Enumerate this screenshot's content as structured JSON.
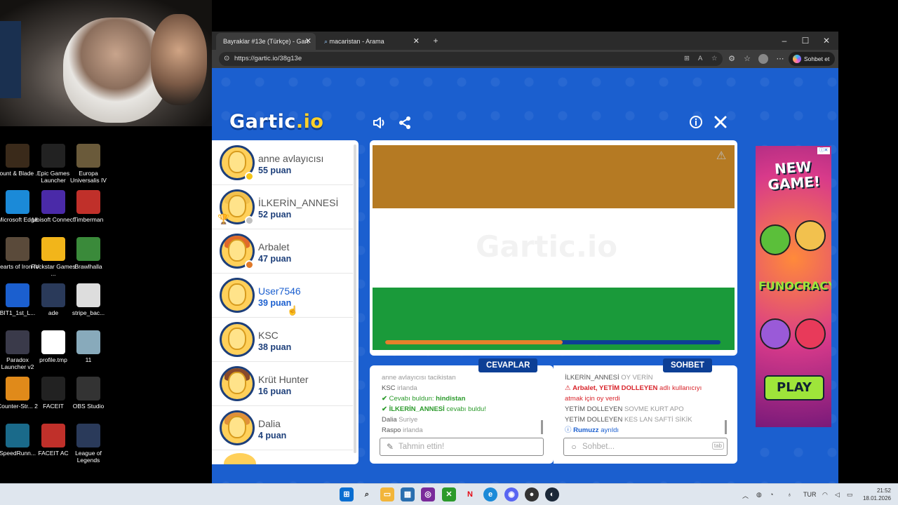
{
  "desktop": {
    "icons": [
      {
        "label": "Mount & Blade ...",
        "icon": "mount-blade-icon"
      },
      {
        "label": "Epic Games Launcher",
        "icon": "epic-games-icon"
      },
      {
        "label": "Europa Universalis IV",
        "icon": "europa-universalis-icon"
      },
      {
        "label": "Microsoft Edge",
        "icon": "edge-icon"
      },
      {
        "label": "Ubisoft Connect",
        "icon": "ubisoft-icon"
      },
      {
        "label": "Timberman",
        "icon": "timberman-icon"
      },
      {
        "label": "Hearts of Iron IV",
        "icon": "hearts-of-iron-icon"
      },
      {
        "label": "Rockstar Games ...",
        "icon": "rockstar-icon"
      },
      {
        "label": "Brawlhalla",
        "icon": "brawlhalla-icon"
      },
      {
        "label": "BIT1_1st_L...",
        "icon": "word-doc-icon"
      },
      {
        "label": "ade",
        "icon": "league-icon"
      },
      {
        "label": "stripe_bac...",
        "icon": "file-icon"
      },
      {
        "label": "Paradox Launcher v2",
        "icon": "paradox-icon"
      },
      {
        "label": "profile.tmp",
        "icon": "blank-file-icon"
      },
      {
        "label": "11",
        "icon": "image-file-icon"
      },
      {
        "label": "Counter-Str... 2",
        "icon": "cs2-icon"
      },
      {
        "label": "FACEIT",
        "icon": "faceit-icon"
      },
      {
        "label": "OBS Studio",
        "icon": "obs-icon"
      },
      {
        "label": "SpeedRunn...",
        "icon": "speedrunners-icon"
      },
      {
        "label": "FACEIT AC",
        "icon": "faceit-ac-icon"
      },
      {
        "label": "League of Legends",
        "icon": "league-icon"
      }
    ]
  },
  "browser": {
    "tabs": [
      {
        "title": "Bayraklar #13e (Türkçe) - Gart"
      },
      {
        "title": "macaristan - Arama"
      }
    ],
    "url": "https://gartic.io/38g13e",
    "copilot_label": "Sohbet et"
  },
  "game": {
    "logo_main": "Gartic",
    "logo_suffix": ".io",
    "players": [
      {
        "name": "anne avlayıcısı",
        "score": "55 puan",
        "status": "guessed",
        "hair": "none",
        "dot": "#f5c518",
        "highlight": false,
        "trophy": false
      },
      {
        "name": "İLKERİN_ANNESİ",
        "score": "52 puan",
        "status": "guessed",
        "hair": "#f2c14e",
        "dot": "#c0c0c0",
        "highlight": false,
        "trophy": true
      },
      {
        "name": "Arbalet",
        "score": "47 puan",
        "status": "none",
        "hair": "#e06a2a",
        "dot": "#e07a2a",
        "highlight": false,
        "trophy": false
      },
      {
        "name": "User7546",
        "score": "39 puan",
        "status": "drawing",
        "hair": "none",
        "dot": "",
        "highlight": true,
        "trophy": false
      },
      {
        "name": "KSC",
        "score": "38 puan",
        "status": "none",
        "hair": "none",
        "dot": "",
        "highlight": false,
        "trophy": false
      },
      {
        "name": "Krüt Hunter",
        "score": "16 puan",
        "status": "none",
        "hair": "#8a4a2a",
        "dot": "",
        "highlight": false,
        "trophy": false
      },
      {
        "name": "Dalia",
        "score": "4 puan",
        "status": "none",
        "hair": "#e0903a",
        "dot": "",
        "highlight": false,
        "trophy": false
      }
    ],
    "canvas": {
      "watermark": "Gartic.io",
      "stripes": [
        "#b57a23",
        "#ffffff",
        "#1a9a3a"
      ],
      "progress_fraction": 0.53
    },
    "answers": {
      "title": "CEVAPLAR",
      "messages": [
        {
          "parts": [
            {
              "text": "anne avlayıcısı",
              "cls": "light"
            },
            {
              "text": " tacikistan",
              "cls": "light"
            }
          ]
        },
        {
          "parts": [
            {
              "text": "KSC",
              "cls": "gray"
            },
            {
              "text": " irlanda",
              "cls": "light"
            }
          ]
        },
        {
          "parts": [
            {
              "text": "✔ ",
              "cls": "green"
            },
            {
              "text": "Cevabı buldun: ",
              "cls": "green-normal"
            },
            {
              "text": "hindistan",
              "cls": "green"
            }
          ]
        },
        {
          "parts": [
            {
              "text": "✔ ",
              "cls": "green"
            },
            {
              "text": "İLKERİN_ANNESİ",
              "cls": "green"
            },
            {
              "text": " cevabı buldu!",
              "cls": "green-normal"
            }
          ]
        },
        {
          "parts": [
            {
              "text": "Dalia",
              "cls": "gray"
            },
            {
              "text": " Suriye",
              "cls": "light"
            }
          ]
        },
        {
          "parts": [
            {
              "text": "Raspo",
              "cls": "gray"
            },
            {
              "text": " irlanda",
              "cls": "light"
            }
          ]
        }
      ],
      "input_placeholder": "Tahmin ettin!"
    },
    "chat": {
      "title": "SOHBET",
      "messages": [
        {
          "parts": [
            {
              "text": "İLKERİN_ANNESİ",
              "cls": "gray"
            },
            {
              "text": " OY VERİN",
              "cls": "light"
            }
          ]
        },
        {
          "parts": [
            {
              "text": "⚠ ",
              "cls": "red"
            },
            {
              "text": "Arbalet, YETİM DOLLEYEN",
              "cls": "red-bold"
            },
            {
              "text": " adlı kullanıcıyı",
              "cls": "red"
            }
          ]
        },
        {
          "parts": [
            {
              "text": "atmak için oy verdi",
              "cls": "red"
            }
          ]
        },
        {
          "parts": [
            {
              "text": "YETİM DOLLEYEN",
              "cls": "gray"
            },
            {
              "text": " SOVME KURT APO",
              "cls": "light"
            }
          ]
        },
        {
          "parts": [
            {
              "text": "YETİM DOLLEYEN",
              "cls": "gray"
            },
            {
              "text": " KES LAN SAFTİ SİKİK",
              "cls": "light"
            }
          ]
        },
        {
          "parts": [
            {
              "text": "ⓘ ",
              "cls": "blue"
            },
            {
              "text": "Rumuzz",
              "cls": "blue-bold"
            },
            {
              "text": " ayrıldı",
              "cls": "blue"
            }
          ]
        }
      ],
      "input_placeholder": "Sohbet...",
      "tab_hint": "tab"
    },
    "ad": {
      "headline": "NEW GAME!",
      "brand": "FUNOCRACY",
      "cta": "PLAY"
    }
  },
  "taskbar": {
    "language": "TUR",
    "time": "21:52",
    "date": "18.01.2026"
  }
}
